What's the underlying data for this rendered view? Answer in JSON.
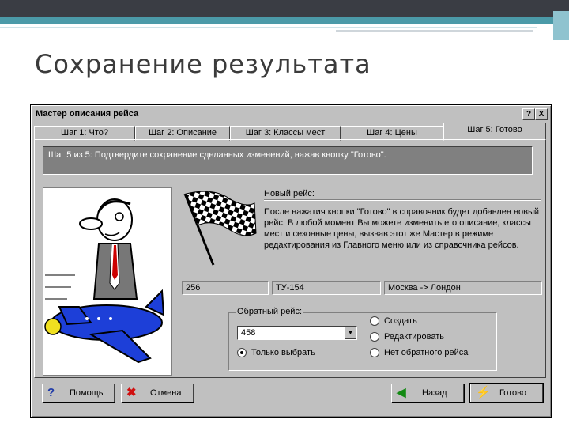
{
  "slide": {
    "title": "Сохранение результата"
  },
  "dialog": {
    "title": "Мастер описания рейса",
    "title_buttons": {
      "help": "?",
      "close": "X"
    },
    "tabs": [
      {
        "label": "Шаг 1: Что?"
      },
      {
        "label": "Шаг 2: Описание"
      },
      {
        "label": "Шаг 3: Классы мест"
      },
      {
        "label": "Шаг 4: Цены"
      },
      {
        "label": "Шаг 5: Готово"
      }
    ],
    "active_tab": 4,
    "info": "Шаг 5 из 5: Подтвердите сохранение сделанных изменений, нажав кнопку \"Готово\".",
    "new_flight_label": "Новый рейс:",
    "description": "После нажатия кнопки \"Готово\" в справочник будет добавлен новый рейс. В любой момент Вы можете изменить его описание, классы мест и сезонные цены, вызвав этот же Мастер в режиме редактирования из Главного меню или из справочника рейсов.",
    "fields": {
      "number": "256",
      "aircraft": "ТУ-154",
      "route": "Москва -> Лондон"
    },
    "return_flight": {
      "label": "Обратный рейс:",
      "combo_value": "458",
      "options": {
        "create": "Создать",
        "edit": "Редактировать",
        "only_select": "Только выбрать",
        "no_return": "Нет обратного рейса"
      },
      "selected": "only_select"
    },
    "buttons": {
      "help": "Помощь",
      "cancel": "Отмена",
      "back": "Назад",
      "done": "Готово"
    }
  },
  "icons": {
    "help": "question-icon",
    "cancel": "red-x-icon",
    "back": "green-arrow-left-icon",
    "done": "lightning-icon",
    "flag": "checkered-flag-icon"
  },
  "colors": {
    "info_bg": "#808080",
    "window": "#c0c0c0",
    "help_icon": "#1f3aa8",
    "cancel_icon": "#d01010",
    "back_icon": "#138a13"
  }
}
